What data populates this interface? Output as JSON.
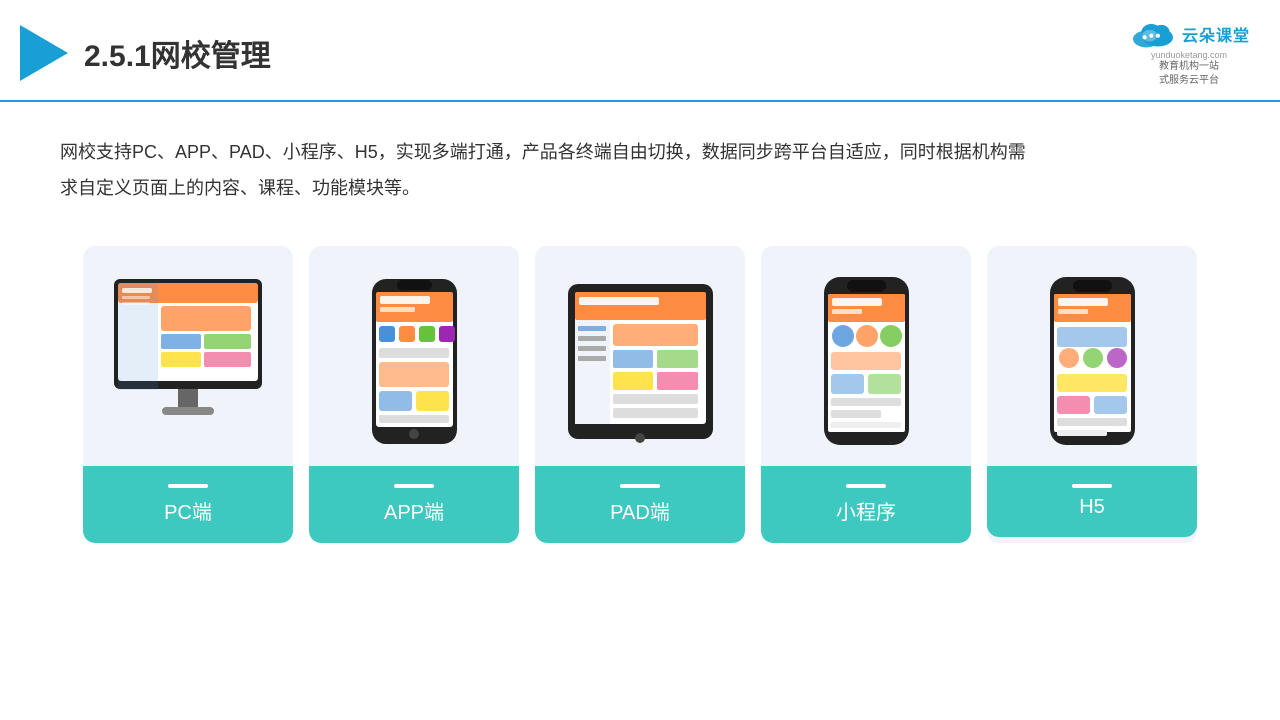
{
  "header": {
    "title": "2.5.1网校管理",
    "brand": {
      "name": "云朵课堂",
      "url": "yunduoketang.com",
      "tagline": "教育机构一站\n式服务云平台"
    }
  },
  "description": {
    "text": "网校支持PC、APP、PAD、小程序、H5，实现多端打通，产品各终端自由切换，数据同步跨平台自适应，同时根据机构需求自定义页面上的内容、课程、功能模块等。"
  },
  "cards": [
    {
      "id": "pc",
      "label": "PC端"
    },
    {
      "id": "app",
      "label": "APP端"
    },
    {
      "id": "pad",
      "label": "PAD端"
    },
    {
      "id": "miniprogram",
      "label": "小程序"
    },
    {
      "id": "h5",
      "label": "H5"
    }
  ],
  "label_bar": "─"
}
